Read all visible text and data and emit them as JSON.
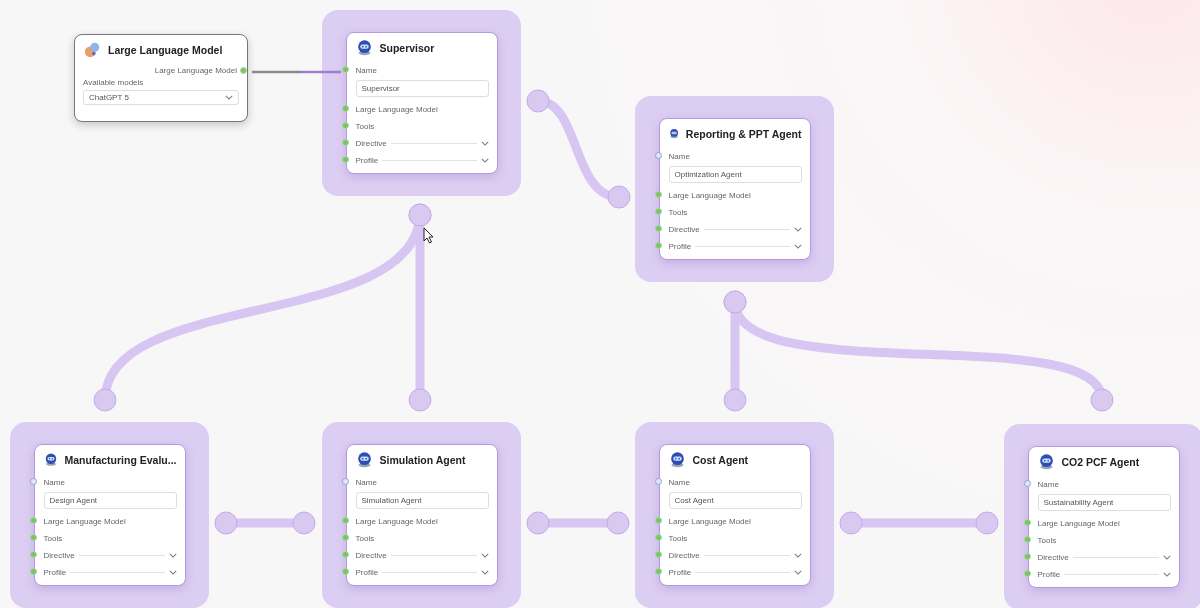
{
  "llm_node": {
    "title": "Large Language Model",
    "output_port": "Large Language Model",
    "models_label": "Available models",
    "model": "ChatGPT 5"
  },
  "agents": [
    {
      "title": "Supervisor",
      "rows": [
        {
          "kind": "input",
          "label": "Name",
          "value": "Supervisor",
          "connected": true
        },
        {
          "kind": "port",
          "label": "Large Language Model",
          "connected": true
        },
        {
          "kind": "port",
          "label": "Tools",
          "connected": true
        },
        {
          "kind": "dropdown",
          "label": "Directive",
          "connected": true
        },
        {
          "kind": "dropdown",
          "label": "Profile",
          "connected": true
        }
      ]
    },
    {
      "title": "Reporting & PPT Agent",
      "rows": [
        {
          "kind": "input",
          "label": "Name",
          "value": "Optimization Agent",
          "connected": false
        },
        {
          "kind": "port",
          "label": "Large Language Model",
          "connected": true
        },
        {
          "kind": "port",
          "label": "Tools",
          "connected": true
        },
        {
          "kind": "dropdown",
          "label": "Directive",
          "connected": true
        },
        {
          "kind": "dropdown",
          "label": "Profile",
          "connected": true
        }
      ]
    },
    {
      "title": "Manufacturing Evalu...",
      "rows": [
        {
          "kind": "input",
          "label": "Name",
          "value": "Design Agent",
          "connected": false
        },
        {
          "kind": "port",
          "label": "Large Language Model",
          "connected": true
        },
        {
          "kind": "port",
          "label": "Tools",
          "connected": true
        },
        {
          "kind": "dropdown",
          "label": "Directive",
          "connected": true
        },
        {
          "kind": "dropdown",
          "label": "Profile",
          "connected": true
        }
      ]
    },
    {
      "title": "Simulation Agent",
      "rows": [
        {
          "kind": "input",
          "label": "Name",
          "value": "Simulation Agent",
          "connected": false
        },
        {
          "kind": "port",
          "label": "Large Language Model",
          "connected": true
        },
        {
          "kind": "port",
          "label": "Tools",
          "connected": true
        },
        {
          "kind": "dropdown",
          "label": "Directive",
          "connected": true
        },
        {
          "kind": "dropdown",
          "label": "Profile",
          "connected": true
        }
      ]
    },
    {
      "title": "Cost Agent",
      "rows": [
        {
          "kind": "input",
          "label": "Name",
          "value": "Cost Agent",
          "connected": false
        },
        {
          "kind": "port",
          "label": "Large Language Model",
          "connected": true
        },
        {
          "kind": "port",
          "label": "Tools",
          "connected": true
        },
        {
          "kind": "dropdown",
          "label": "Directive",
          "connected": true
        },
        {
          "kind": "dropdown",
          "label": "Profile",
          "connected": true
        }
      ]
    },
    {
      "title": "CO2 PCF Agent",
      "rows": [
        {
          "kind": "input",
          "label": "Name",
          "value": "Sustainability Agent",
          "connected": false
        },
        {
          "kind": "port",
          "label": "Large Language Model",
          "connected": true
        },
        {
          "kind": "port",
          "label": "Tools",
          "connected": true
        },
        {
          "kind": "dropdown",
          "label": "Directive",
          "connected": true
        },
        {
          "kind": "dropdown",
          "label": "Profile",
          "connected": true
        }
      ]
    }
  ]
}
